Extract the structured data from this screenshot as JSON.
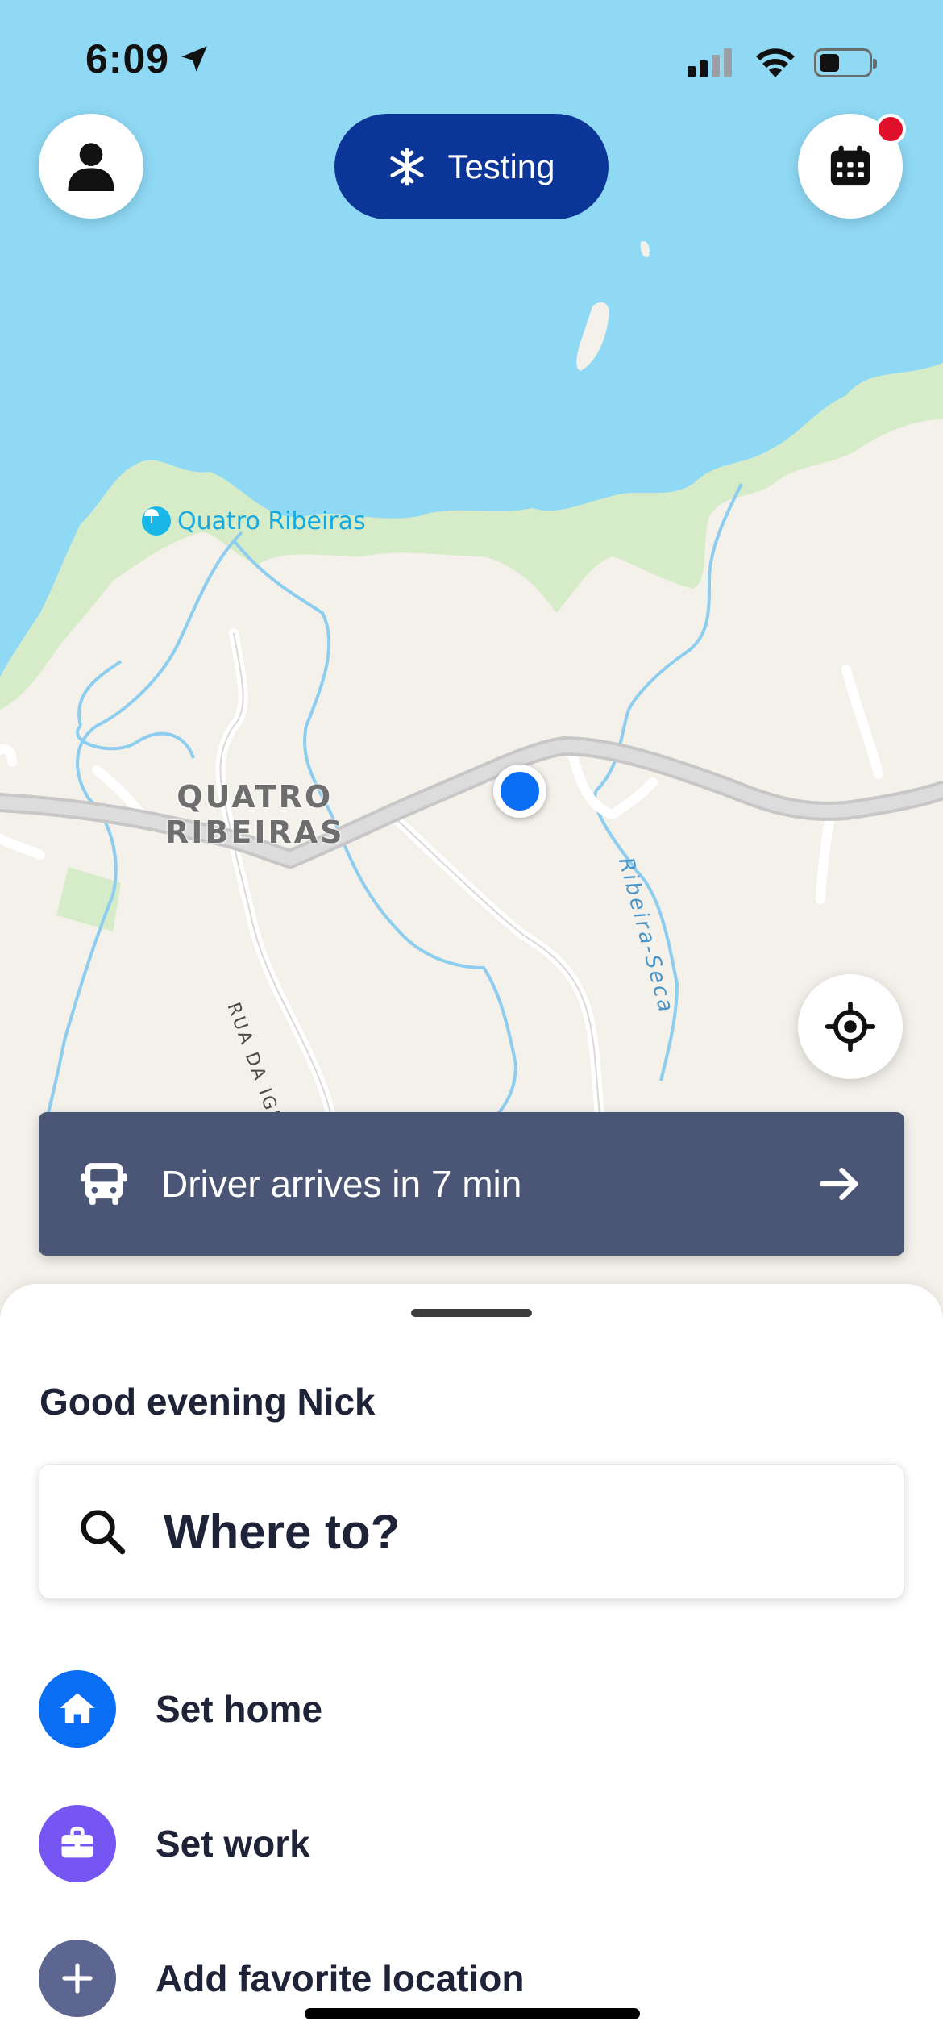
{
  "status_bar": {
    "time": "6:09"
  },
  "header": {
    "mode_pill_label": "Testing"
  },
  "map": {
    "labels": {
      "beach_poi": "Quatro Ribeiras",
      "town_line1": "QUATRO",
      "town_line2": "RIBEIRAS",
      "street": "RUA DA IGREJA",
      "river": "Ribeira-Seca"
    }
  },
  "driver_banner": {
    "text": "Driver arrives in 7 min"
  },
  "sheet": {
    "greeting": "Good evening Nick",
    "search_label": "Where to?",
    "items": [
      {
        "label": "Set home",
        "icon": "home-icon",
        "color": "#0a6ef5"
      },
      {
        "label": "Set work",
        "icon": "briefcase-icon",
        "color": "#7656f2"
      },
      {
        "label": "Add favorite location",
        "icon": "plus-icon",
        "color": "#5c6690"
      }
    ]
  },
  "colors": {
    "water": "#8fd9f5",
    "land": "#f3f1ea",
    "vegetation": "#d6ecc8",
    "river": "#8ccdf0",
    "road": "#d3d3d3",
    "pill": "#0b3597",
    "banner": "#4b5576",
    "location_dot": "#0a6ef5",
    "notification": "#e00f2a"
  }
}
